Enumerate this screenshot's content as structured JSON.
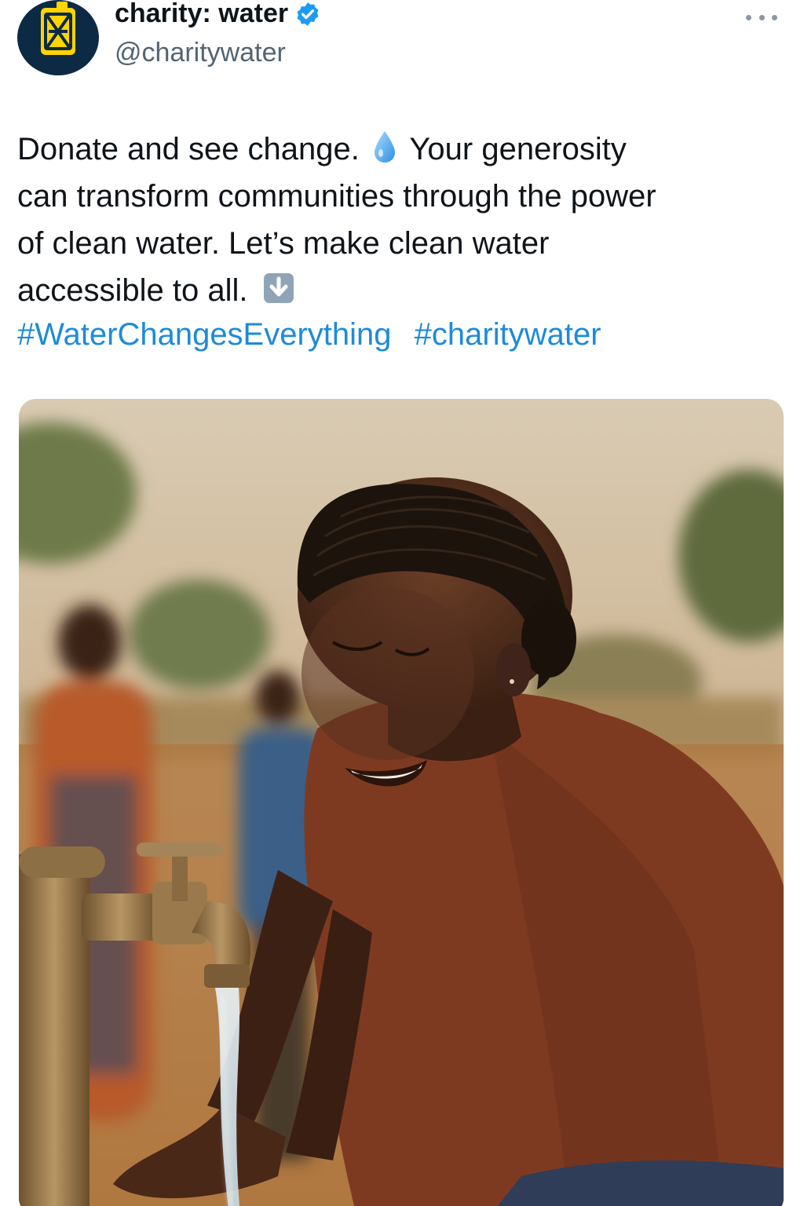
{
  "author": {
    "display_name": "charity: water",
    "handle": "@charitywater",
    "verified": true,
    "avatar_icon": "jerrycan-icon",
    "colors": {
      "avatar_bg": "#0d2a45",
      "avatar_can": "#ffd400",
      "verified": "#1d9bf0"
    }
  },
  "tweet": {
    "lines": [
      "Donate and see change.",
      "Your generosity",
      "can transform communities through the power",
      "of clean water. Let’s make clean water",
      "accessible to all."
    ],
    "hashtags": [
      "#WaterChangesEverything",
      "#charitywater"
    ],
    "link_color": "#1d8bd8"
  },
  "icons": {
    "more": "more-options-icon",
    "drop": "water-drop-emoji",
    "arrow": "down-arrow-emoji"
  },
  "media": {
    "type": "photo",
    "alt": "photo-woman-washing-hands-at-tap"
  }
}
